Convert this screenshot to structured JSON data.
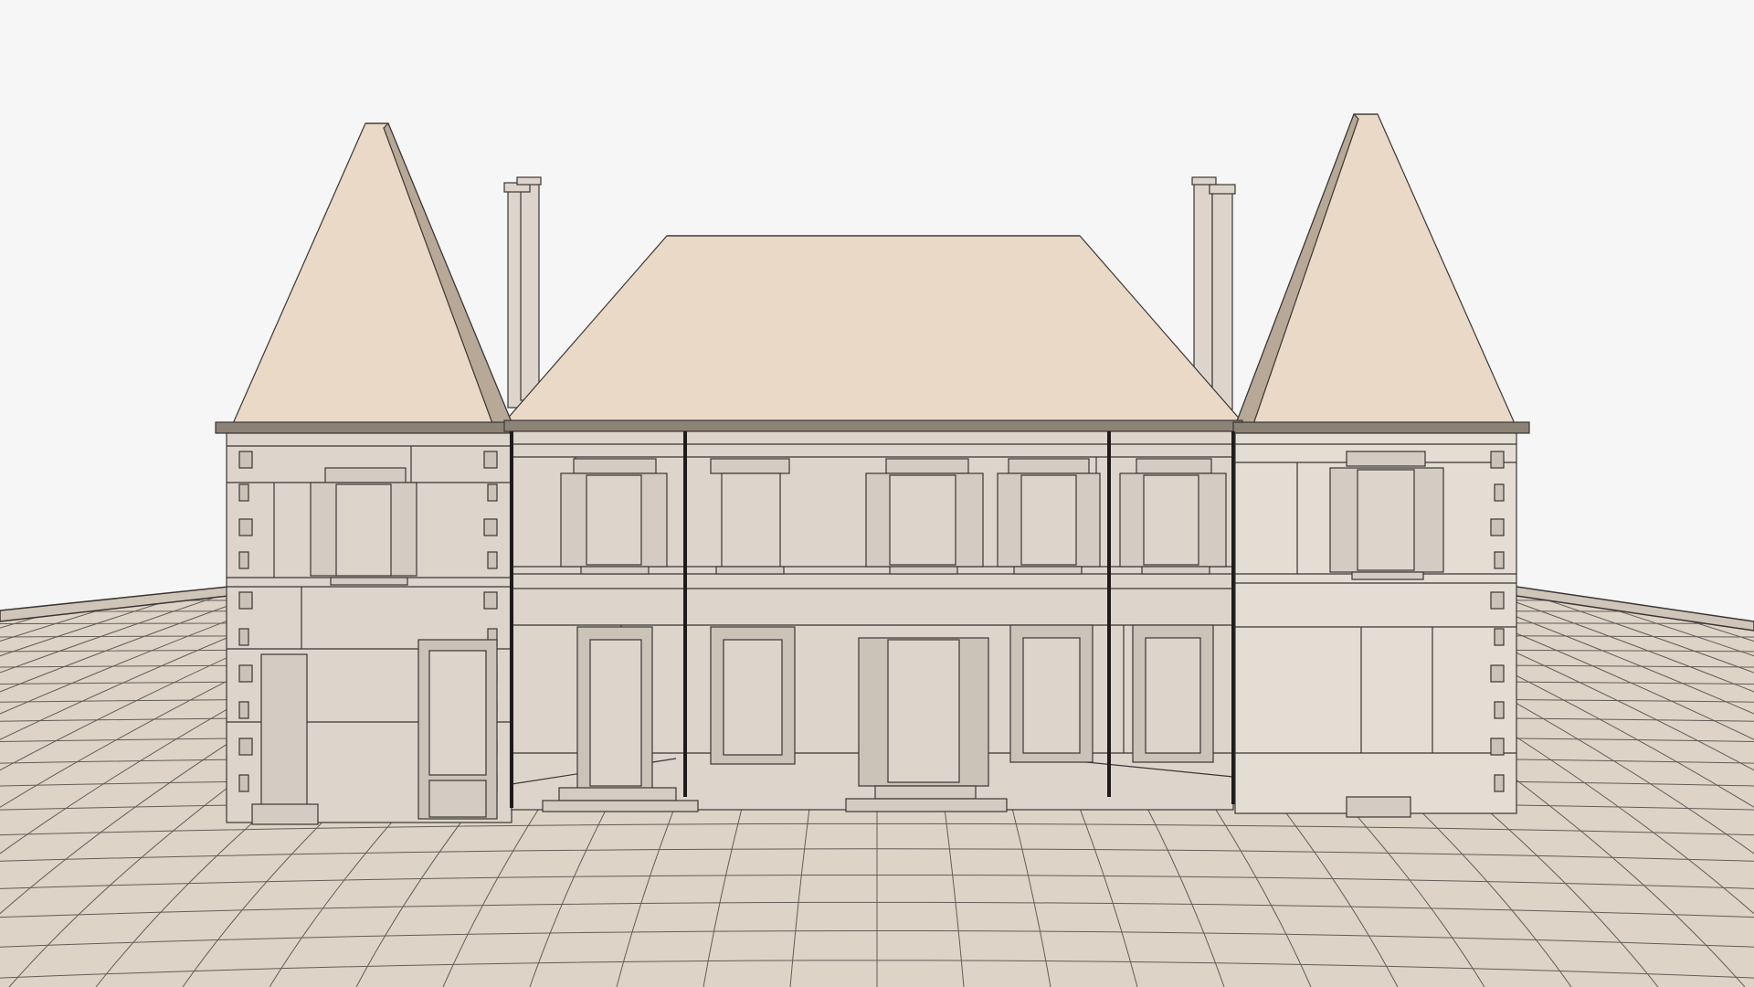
{
  "scene": {
    "kind": "3d-model-render",
    "subject": "chateau-facade-wireframe",
    "colors": {
      "background": "#f6f6f6",
      "wall": "#ddd5cc",
      "wall_light": "#e4ddd4",
      "wall_dark": "#cbc2b8",
      "roof": "#ead9c7",
      "roof_shadow": "#b7a897",
      "line": "#3a3634",
      "ground": "#ddd3c6",
      "ground_rim": "#cfc5b8"
    }
  }
}
